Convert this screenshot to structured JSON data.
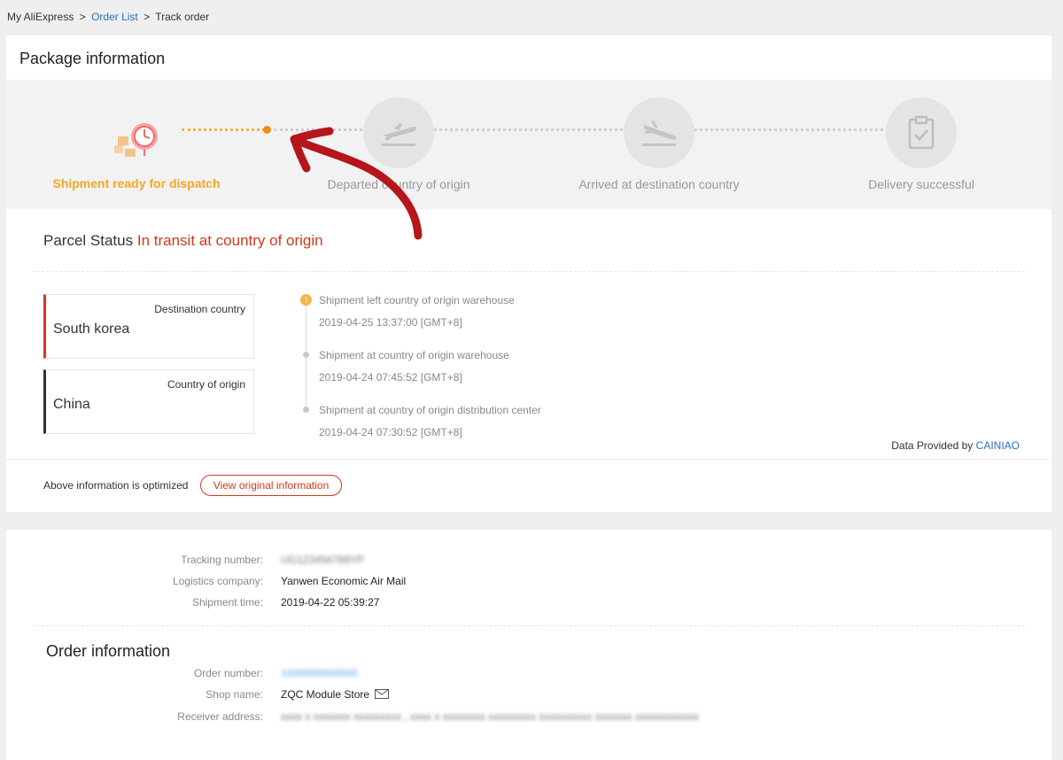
{
  "breadcrumb": {
    "home": "My AliExpress",
    "sep": ">",
    "orders": "Order List",
    "current": "Track order"
  },
  "package": {
    "title": "Package information",
    "steps": [
      {
        "label": "Shipment ready for dispatch",
        "icon": "package-clock-icon",
        "active": true
      },
      {
        "label": "Departed country of origin",
        "icon": "airplane-takeoff-icon",
        "active": false
      },
      {
        "label": "Arrived at destination country",
        "icon": "airplane-landing-icon",
        "active": false
      },
      {
        "label": "Delivery successful",
        "icon": "clipboard-check-icon",
        "active": false
      }
    ],
    "parcel_status_label": "Parcel Status",
    "parcel_status_value": "In transit at country of origin",
    "destination": {
      "label": "Destination country",
      "name": "South korea"
    },
    "origin": {
      "label": "Country of origin",
      "name": "China"
    },
    "timeline": [
      {
        "event": "Shipment left country of origin warehouse",
        "time": "2019-04-25 13:37:00 [GMT+8]"
      },
      {
        "event": "Shipment at country of origin warehouse",
        "time": "2019-04-24 07:45:52 [GMT+8]"
      },
      {
        "event": "Shipment at country of origin distribution center",
        "time": "2019-04-24 07:30:52 [GMT+8]"
      }
    ],
    "provided_by_prefix": "Data Provided by",
    "provided_by": "CAINIAO",
    "optimized_text": "Above information is optimized",
    "view_original": "View original information"
  },
  "shipping": {
    "tracking_label": "Tracking number:",
    "tracking_value": "UG123456789YP",
    "logistics_label": "Logistics company:",
    "logistics_value": "Yanwen Economic Air Mail",
    "shipment_time_label": "Shipment time:",
    "shipment_time_value": "2019-04-22 05:39:27"
  },
  "order": {
    "title": "Order information",
    "order_number_label": "Order number:",
    "order_number_value": "1000000000000",
    "shop_label": "Shop name:",
    "shop_value": "ZQC Module Store",
    "address_label": "Receiver address:",
    "address_value": "xxxx x xxxxxxx xxxxxxxxx , xxxx x xxxxxxxx xxxxxxxxx xxxxxxxxxx xxxxxxx xxxxxxxxxxxx"
  },
  "colors": {
    "accent_orange": "#f5a623",
    "status_red": "#d03a1b",
    "link_blue": "#2a6ebb",
    "annotation_red": "#b5151b"
  }
}
